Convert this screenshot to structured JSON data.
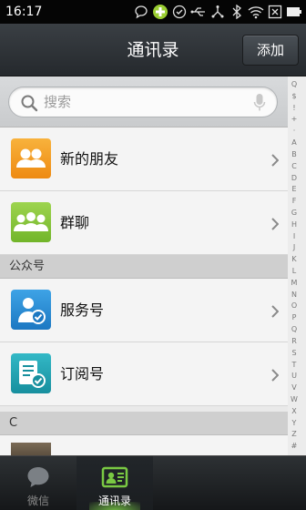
{
  "status_bar": {
    "time": "16:17",
    "icons": [
      "chat-bubble-icon",
      "green-plus-icon",
      "check-circle-icon",
      "usb-icon",
      "network-icon",
      "bluetooth-icon",
      "wifi-icon",
      "close-box-icon",
      "battery-icon"
    ]
  },
  "header": {
    "title": "通讯录",
    "add_label": "添加"
  },
  "search": {
    "placeholder": "搜索"
  },
  "rows": {
    "new_friends": "新的朋友",
    "group_chat": "群聊",
    "service": "服务号",
    "subscription": "订阅号"
  },
  "sections": {
    "public_accounts": "公众号",
    "letter_c": "C"
  },
  "index_bar": [
    "Q",
    "$",
    "!",
    "+",
    "·",
    "A",
    "B",
    "C",
    "D",
    "E",
    "F",
    "G",
    "H",
    "I",
    "J",
    "K",
    "L",
    "M",
    "N",
    "O",
    "P",
    "Q",
    "R",
    "S",
    "T",
    "U",
    "V",
    "W",
    "X",
    "Y",
    "Z",
    "#"
  ],
  "tabs": [
    {
      "label": "微信",
      "active": false
    },
    {
      "label": "通讯录",
      "active": true
    }
  ],
  "colors": {
    "accent_green": "#7ac943",
    "orange_avatar": "#f39a1e",
    "green_avatar": "#8cc63f",
    "blue_avatar": "#2b8fd6",
    "teal_avatar": "#1fa3b3"
  }
}
